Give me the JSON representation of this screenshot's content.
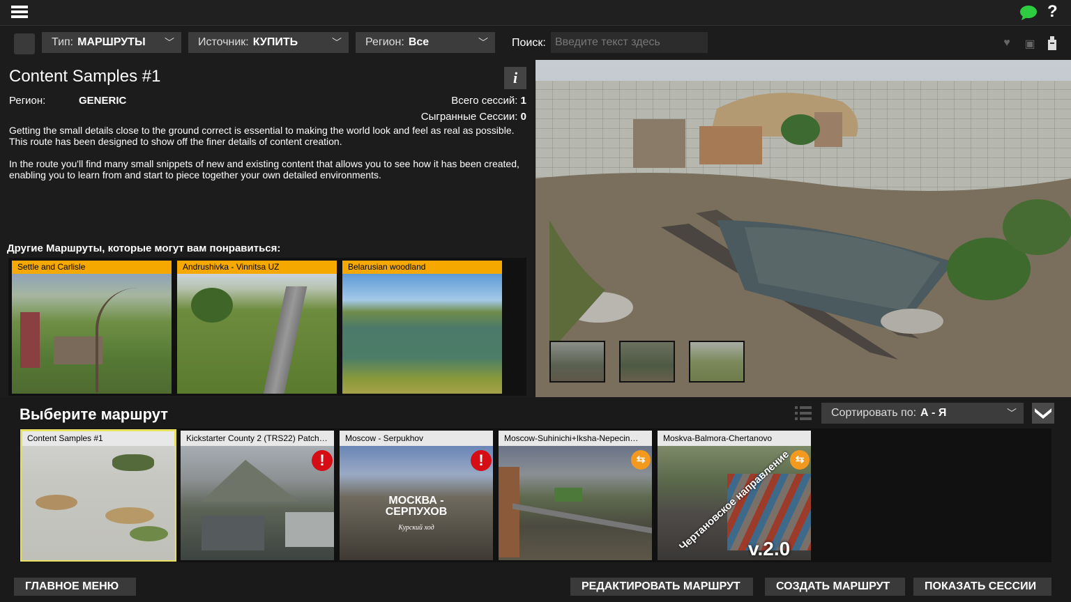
{
  "topbar": {
    "menu_icon": "hamburger-menu-icon",
    "chat_icon": "chat-bubble-icon",
    "help_label": "?"
  },
  "filters": {
    "type_label": "Тип:",
    "type_value": "МАРШРУТЫ",
    "source_label": "Источник:",
    "source_value": "КУПИТЬ",
    "region_label": "Регион:",
    "region_value": "Все",
    "search_label": "Поиск:",
    "search_placeholder": "Введите текст здесь"
  },
  "route": {
    "title": "Content Samples #1",
    "info_label": "i",
    "region_label": "Регион:",
    "region_value": "GENERIC",
    "sessions_total_label": "Всего сессий:",
    "sessions_total": "1",
    "sessions_played_label": "Сыгранные Сессии:",
    "sessions_played": "0",
    "description": "Getting the small details close to the ground correct is essential to making the world look and feel as real as possible. This route has been designed to show off the finer details of content creation.\n\nIn the route you'll find many small snippets of new and existing content that allows you to see how it has been created, enabling you to learn from and start to piece together your own detailed environments."
  },
  "others": {
    "title": "Другие Маршруты, которые могут вам понравиться:",
    "items": [
      {
        "label": "Settle and Carlisle"
      },
      {
        "label": "Andrushivka - Vinnitsa UZ"
      },
      {
        "label": "Belarusian woodland"
      }
    ]
  },
  "choose": {
    "title": "Выберите маршрут",
    "sort_label": "Сортировать по:",
    "sort_value": "А - Я",
    "routes": [
      {
        "label": "Content Samples #1",
        "badge": ""
      },
      {
        "label": "Kickstarter County 2 (TRS22) Patch…",
        "badge": "warning"
      },
      {
        "label": "Moscow - Serpukhov",
        "badge": "warning",
        "overlay_1": "МОСКВА -",
        "overlay_2": "СЕРПУХОВ",
        "overlay_3": "Курский ход"
      },
      {
        "label": "Moscow-Suhinichi+Iksha-Nepecin…",
        "badge": "link"
      },
      {
        "label": "Moskva-Balmora-Chertanovo",
        "badge": "link",
        "overlay_1": "Чертановское направление",
        "overlay_2": "v.2.0"
      }
    ]
  },
  "buttons": {
    "main_menu": "ГЛАВНОЕ МЕНЮ",
    "edit_route": "РЕДАКТИРОВАТЬ МАРШРУТ",
    "create_route": "СОЗДАТЬ МАРШРУТ",
    "show_sessions": "ПОКАЗАТЬ СЕССИИ"
  },
  "colors": {
    "accent_orange": "#f5a800",
    "selected_outline": "#e8e060",
    "warning_red": "#d40e14",
    "link_orange": "#f39a1e"
  }
}
